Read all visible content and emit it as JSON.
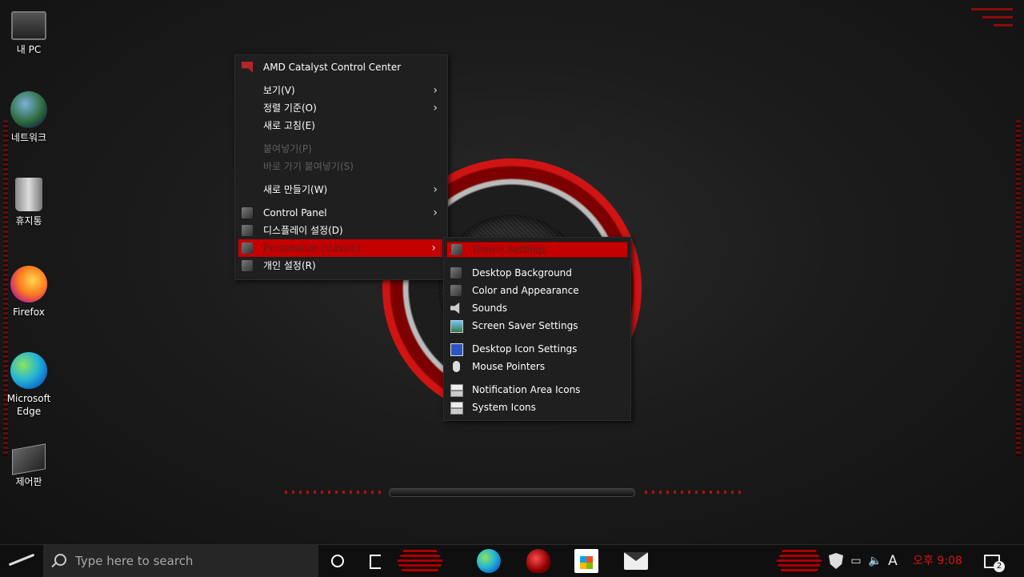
{
  "desktop": {
    "icons": [
      {
        "label": "내 PC",
        "icon": "computer-icon"
      },
      {
        "label": "네트워크",
        "icon": "network-globe-icon"
      },
      {
        "label": "휴지통",
        "icon": "recycle-bin-icon"
      },
      {
        "label": "Firefox",
        "icon": "firefox-icon"
      },
      {
        "label": "Microsoft Edge",
        "icon": "edge-icon"
      },
      {
        "label": "제어판",
        "icon": "control-panel-icon"
      }
    ]
  },
  "context_menu": {
    "items": [
      {
        "label": "AMD Catalyst Control Center",
        "icon": "amd-icon",
        "submenu": false,
        "disabled": false
      },
      {
        "label": "보기(V)",
        "submenu": true,
        "disabled": false
      },
      {
        "label": "정렬 기준(O)",
        "submenu": true,
        "disabled": false
      },
      {
        "label": "새로 고침(E)",
        "submenu": false,
        "disabled": false
      },
      {
        "label": "붙여넣기(P)",
        "submenu": false,
        "disabled": true
      },
      {
        "label": "바로 가기 붙여넣기(S)",
        "submenu": false,
        "disabled": true
      },
      {
        "label": "새로 만들기(W)",
        "submenu": true,
        "disabled": false
      },
      {
        "label": "Control Panel",
        "icon": "control-panel-icon",
        "submenu": true,
        "disabled": false
      },
      {
        "label": "디스플레이 설정(D)",
        "icon": "display-settings-icon",
        "submenu": false,
        "disabled": false
      },
      {
        "label": "Personalize (classic)",
        "icon": "personalize-icon",
        "submenu": true,
        "disabled": false,
        "highlighted": true
      },
      {
        "label": "개인 설정(R)",
        "icon": "personalization-icon",
        "submenu": false,
        "disabled": false
      }
    ]
  },
  "submenu": {
    "items": [
      {
        "label": "Theme Settings",
        "icon": "theme-settings-icon",
        "highlighted": true
      },
      {
        "label": "Desktop Background",
        "icon": "desktop-background-icon"
      },
      {
        "label": "Color and Appearance",
        "icon": "color-appearance-icon"
      },
      {
        "label": "Sounds",
        "icon": "speaker-icon"
      },
      {
        "label": "Screen Saver Settings",
        "icon": "screen-saver-icon"
      },
      {
        "label": "Desktop Icon Settings",
        "icon": "desktop-icon-settings-icon"
      },
      {
        "label": "Mouse Pointers",
        "icon": "mouse-icon"
      },
      {
        "label": "Notification Area Icons",
        "icon": "notification-area-icon"
      },
      {
        "label": "System Icons",
        "icon": "system-icons-icon"
      }
    ]
  },
  "taskbar": {
    "search_placeholder": "Type here to search",
    "clock": "오후 9:08",
    "input_indicator": "A",
    "notification_count": "2",
    "apps": [
      "edge-icon",
      "rog-icon",
      "store-icon",
      "mail-icon"
    ]
  },
  "colors": {
    "accent": "#c40000",
    "clock": "#d31414",
    "menu_bg": "#1f1f1f"
  }
}
